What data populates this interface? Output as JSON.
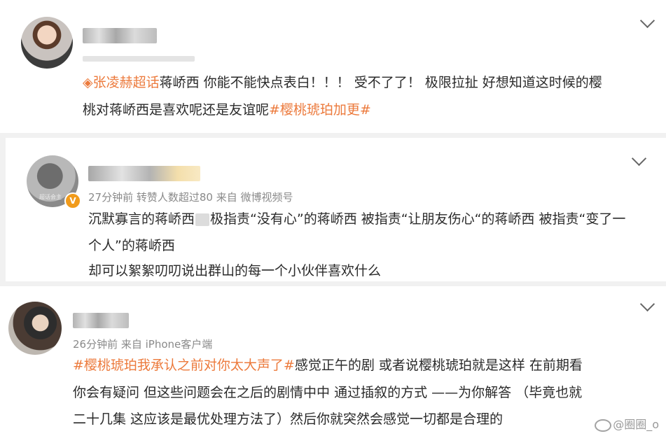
{
  "posts": [
    {
      "meta": "",
      "supertopic": "张凌赫超话",
      "line1": "蒋峤西 你能不能快点表白！！！ 受不了了！ 极限拉扯 好想知道这时候的樱",
      "line2": "桃对蒋峤西是喜欢呢还是友谊呢",
      "hashtag": "#樱桃琥珀加更#"
    },
    {
      "avatar_text": "超话会主",
      "meta": "27分钟前 转赞人数超过80 来自 微博视频号",
      "line1a": "沉默寡言的蒋峤西",
      "line1b": "极指责“没有心”的蒋峤西 被指责“让朋友伤心“的蒋峤西 被指责“变了一",
      "line2": "个人”的蒋峤西",
      "line3": "却可以絮絮叨叨说出群山的每一个小伙伴喜欢什么"
    },
    {
      "meta": "26分钟前 来自 iPhone客户端",
      "hashtag": "#樱桃琥珀我承认之前对你太大声了#",
      "line1": "感觉正午的剧 或者说樱桃琥珀就是这样 在前期看",
      "line2": "你会有疑问 但这些问题会在之后的剧情中中 通过插叙的方式 ——为你解答 （毕竟也就",
      "line3": "二十几集 这应该是最优处理方法了）然后你就突然会感觉一切都是合理的"
    }
  ],
  "watermark": "@圈圈_o",
  "icons": [
    "chevron-down-icon",
    "supertopic-icon",
    "verified-badge-icon",
    "weibo-logo-icon"
  ],
  "colors": {
    "tag": "#ec7a3c",
    "meta": "#8a8a8a",
    "badge": "#f19b1b"
  }
}
